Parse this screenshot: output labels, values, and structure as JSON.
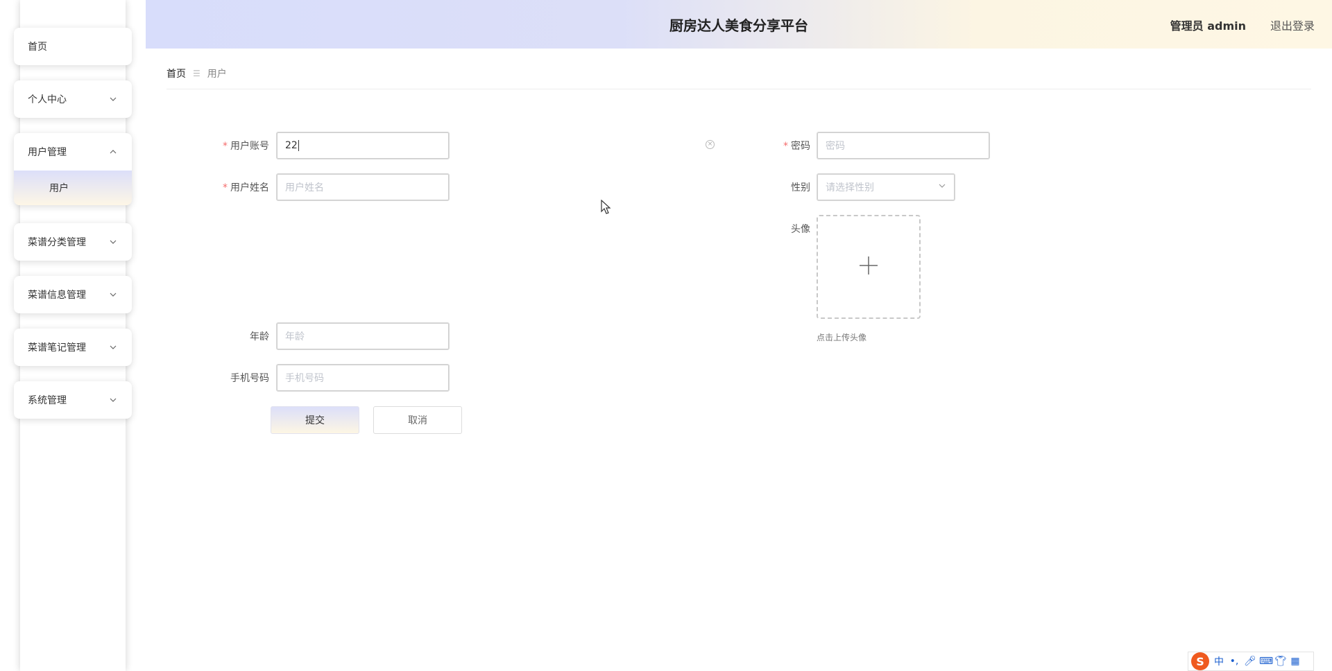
{
  "app": {
    "title": "厨房达人美食分享平台",
    "user_label": "管理员 admin",
    "logout_label": "退出登录"
  },
  "sidebar": {
    "items": [
      {
        "label": "首页"
      },
      {
        "label": "个人中心"
      },
      {
        "label": "用户管理",
        "expanded": true,
        "children": [
          {
            "label": "用户",
            "active": true
          }
        ]
      },
      {
        "label": "菜谱分类管理"
      },
      {
        "label": "菜谱信息管理"
      },
      {
        "label": "菜谱笔记管理"
      },
      {
        "label": "系统管理"
      }
    ]
  },
  "breadcrumb": {
    "home": "首页",
    "current": "用户"
  },
  "form": {
    "account": {
      "label": "用户账号",
      "value": "22",
      "required": true
    },
    "password": {
      "label": "密码",
      "placeholder": "密码",
      "required": true
    },
    "name": {
      "label": "用户姓名",
      "placeholder": "用户姓名",
      "required": true
    },
    "gender": {
      "label": "性别",
      "placeholder": "请选择性别"
    },
    "avatar": {
      "label": "头像",
      "tip": "点击上传头像"
    },
    "age": {
      "label": "年龄",
      "placeholder": "年龄"
    },
    "phone": {
      "label": "手机号码",
      "placeholder": "手机号码"
    },
    "submit_label": "提交",
    "cancel_label": "取消"
  },
  "ime": {
    "logo": "S",
    "mode": "中",
    "punct": "•,"
  },
  "colors": {
    "accent_start": "#dcdff9",
    "accent_end": "#fdf6e4",
    "required": "#f56c6c"
  }
}
